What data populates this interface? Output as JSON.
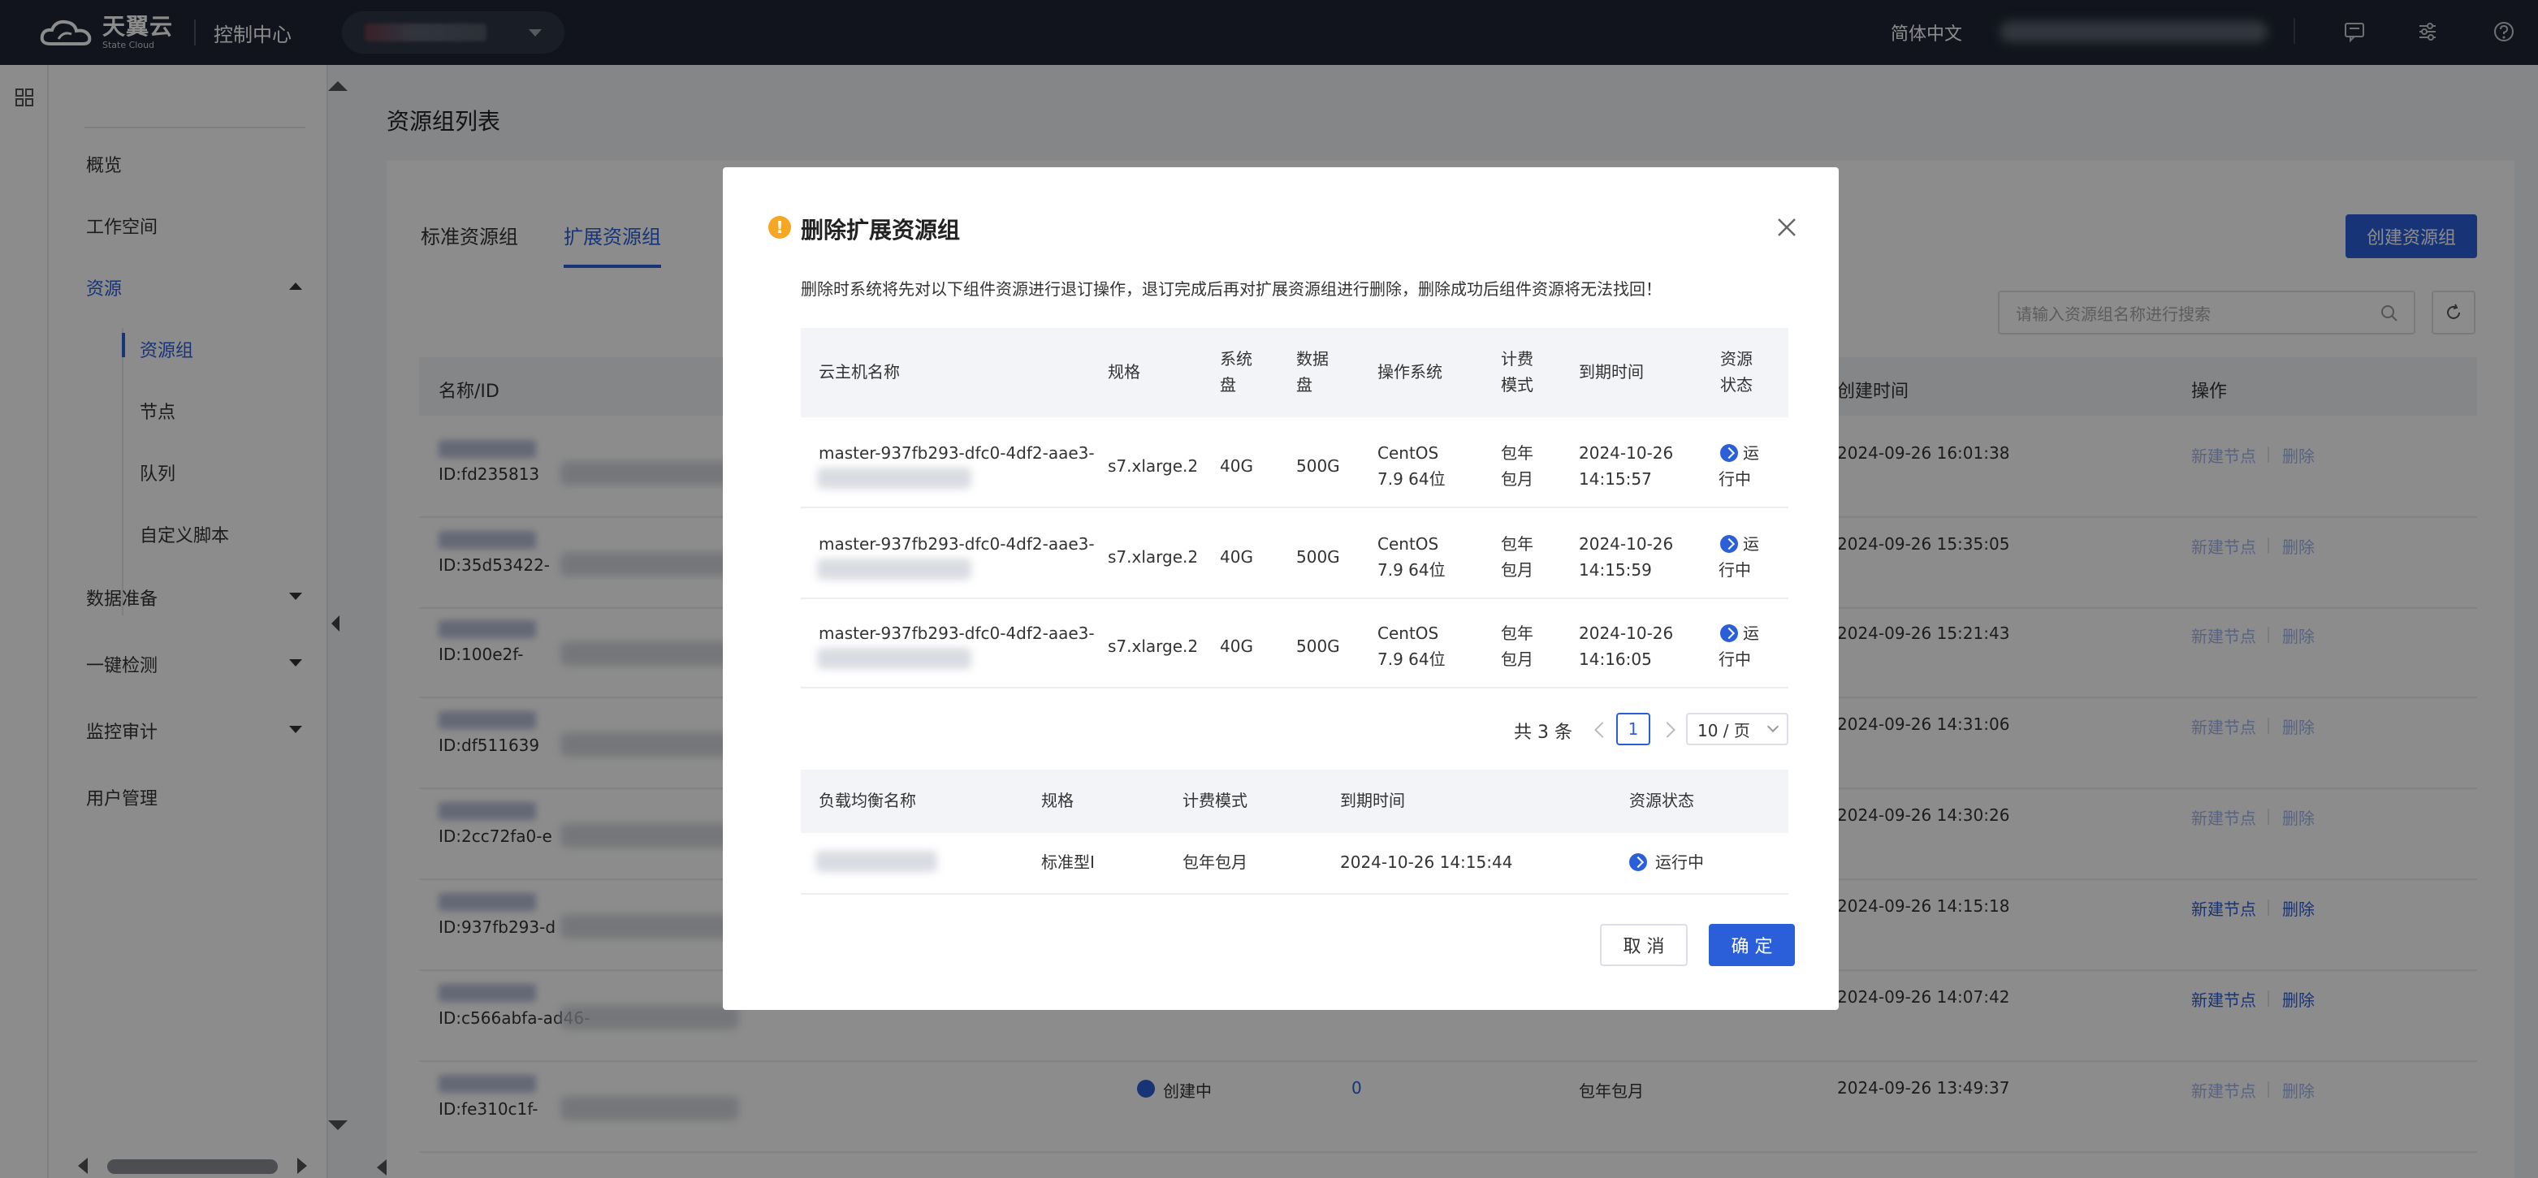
{
  "topbar": {
    "logo_cn": "天翼云",
    "logo_en": "State Cloud",
    "console": "控制中心",
    "language": "简体中文"
  },
  "sidebar": {
    "items": [
      {
        "label": "概览"
      },
      {
        "label": "工作空间"
      },
      {
        "label": "资源"
      },
      {
        "label": "数据准备"
      },
      {
        "label": "一键检测"
      },
      {
        "label": "监控审计"
      },
      {
        "label": "用户管理"
      }
    ],
    "resource_children": [
      {
        "label": "资源组",
        "active": true
      },
      {
        "label": "节点"
      },
      {
        "label": "队列"
      },
      {
        "label": "自定义脚本"
      }
    ]
  },
  "main": {
    "title": "资源组列表",
    "tabs": [
      "标准资源组",
      "扩展资源组"
    ],
    "create_button": "创建资源组",
    "search_placeholder": "请输入资源组名称进行搜索",
    "columns": {
      "name": "名称/ID",
      "created": "创建时间",
      "ops": "操作"
    },
    "rows": [
      {
        "id": "ID:fd235813",
        "created": "2024-09-26 16:01:38"
      },
      {
        "id": "ID:35d53422-",
        "created": "2024-09-26 15:35:05"
      },
      {
        "id": "ID:100e2f-",
        "created": "2024-09-26 15:21:43"
      },
      {
        "id": "ID:df511639",
        "created": "2024-09-26 14:31:06"
      },
      {
        "id": "ID:2cc72fa0-e",
        "created": "2024-09-26 14:30:26"
      },
      {
        "id": "ID:937fb293-d",
        "created": "2024-09-26 14:15:18"
      },
      {
        "id": "ID:c566abfa-ad46-",
        "created": "2024-09-26 14:07:42"
      },
      {
        "id": "ID:fe310c1f-",
        "created": "2024-09-26 13:49:37",
        "status": "创建中",
        "count": "0",
        "billing": "包年包月"
      }
    ],
    "op_new": "新建节点",
    "op_delete": "删除"
  },
  "modal": {
    "title": "删除扩展资源组",
    "description": "删除时系统将先对以下组件资源进行退订操作，退订完成后再对扩展资源组进行删除，删除成功后组件资源将无法找回！",
    "vm_table": {
      "headers": [
        "云主机名称",
        "规格",
        "系统盘",
        "数据盘",
        "操作系统",
        "计费模式",
        "到期时间",
        "资源状态"
      ],
      "rows": [
        {
          "name": "master-937fb293-dfc0-4df2-aae3-",
          "spec": "s7.xlarge.2",
          "sys": "40G",
          "data": "500G",
          "os": "CentOS 7.9 64位",
          "billing": "包年包月",
          "expire": "2024-10-26 14:15:57",
          "status": "运行中"
        },
        {
          "name": "master-937fb293-dfc0-4df2-aae3-",
          "spec": "s7.xlarge.2",
          "sys": "40G",
          "data": "500G",
          "os": "CentOS 7.9 64位",
          "billing": "包年包月",
          "expire": "2024-10-26 14:15:59",
          "status": "运行中"
        },
        {
          "name": "master-937fb293-dfc0-4df2-aae3-",
          "spec": "s7.xlarge.2",
          "sys": "40G",
          "data": "500G",
          "os": "CentOS 7.9 64位",
          "billing": "包年包月",
          "expire": "2024-10-26 14:16:05",
          "status": "运行中"
        }
      ]
    },
    "pager": {
      "total": "共 3 条",
      "current": "1",
      "size": "10 / 页"
    },
    "lb_table": {
      "headers": [
        "负载均衡名称",
        "规格",
        "计费模式",
        "到期时间",
        "资源状态"
      ],
      "row": {
        "spec": "标准型I",
        "billing": "包年包月",
        "expire": "2024-10-26 14:15:44",
        "status": "运行中"
      }
    },
    "cancel": "取 消",
    "confirm": "确 定"
  }
}
